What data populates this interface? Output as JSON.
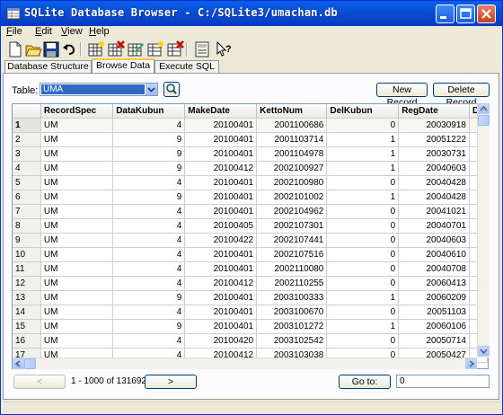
{
  "window": {
    "title": "SQLite Database Browser - C:/SQLite3/umachan.db"
  },
  "menu": [
    "File",
    "Edit",
    "View",
    "Help"
  ],
  "menu_underline": [
    "F",
    "E",
    "V",
    "H"
  ],
  "tabs": [
    "Database Structure",
    "Browse Data",
    "Execute SQL"
  ],
  "browse": {
    "table_label": "Table:",
    "table_value": "UMA",
    "new_record": "New Record",
    "delete_record": "Delete Record"
  },
  "grid": {
    "columns": [
      "RecordSpec",
      "DataKubun",
      "MakeDate",
      "KettoNum",
      "DelKubun",
      "RegDate",
      "De"
    ],
    "rows": [
      [
        "1",
        "UM",
        "4",
        "20100401",
        "2001100686",
        "0",
        "20030918"
      ],
      [
        "2",
        "UM",
        "9",
        "20100401",
        "2001103714",
        "1",
        "20051222"
      ],
      [
        "3",
        "UM",
        "9",
        "20100401",
        "2001104978",
        "1",
        "20030731"
      ],
      [
        "4",
        "UM",
        "9",
        "20100412",
        "2002100927",
        "1",
        "20040603"
      ],
      [
        "5",
        "UM",
        "4",
        "20100401",
        "2002100980",
        "0",
        "20040428"
      ],
      [
        "6",
        "UM",
        "9",
        "20100401",
        "2002101002",
        "1",
        "20040428"
      ],
      [
        "7",
        "UM",
        "4",
        "20100401",
        "2002104962",
        "0",
        "20041021"
      ],
      [
        "8",
        "UM",
        "4",
        "20100405",
        "2002107301",
        "0",
        "20040701"
      ],
      [
        "9",
        "UM",
        "4",
        "20100422",
        "2002107441",
        "0",
        "20040603"
      ],
      [
        "10",
        "UM",
        "4",
        "20100401",
        "2002107516",
        "0",
        "20040610"
      ],
      [
        "11",
        "UM",
        "4",
        "20100401",
        "2002110080",
        "0",
        "20040708"
      ],
      [
        "12",
        "UM",
        "4",
        "20100412",
        "2002110255",
        "0",
        "20060413"
      ],
      [
        "13",
        "UM",
        "9",
        "20100401",
        "2003100333",
        "1",
        "20060209"
      ],
      [
        "14",
        "UM",
        "4",
        "20100401",
        "2003100670",
        "0",
        "20051103"
      ],
      [
        "15",
        "UM",
        "9",
        "20100401",
        "2003101272",
        "1",
        "20060106"
      ],
      [
        "16",
        "UM",
        "4",
        "20100420",
        "2003102542",
        "0",
        "20050714"
      ],
      [
        "17",
        "UM",
        "4",
        "20100412",
        "2003103038",
        "0",
        "20050427"
      ]
    ]
  },
  "pager": {
    "prev": "<",
    "next": ">",
    "range": "1 - 1000 of 131692",
    "goto_label": "Go to:",
    "goto_value": "0"
  }
}
